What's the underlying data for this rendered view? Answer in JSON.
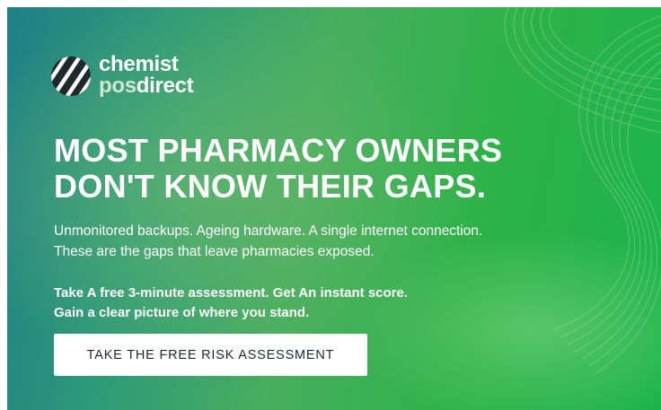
{
  "brand": {
    "word1": "chemist",
    "word2_part1": "pos",
    "word2_part2": "direct",
    "icon": "striped-globe-logo-icon"
  },
  "headline": {
    "line1": "MOST PHARMACY OWNERS",
    "line2": "DON'T KNOW THEIR GAPS."
  },
  "subtext": {
    "line1": "Unmonitored backups. Ageing hardware. A single internet connection.",
    "line2": "These are the gaps that leave pharmacies exposed."
  },
  "offer": {
    "line1": "Take A free 3-minute assessment. Get An instant score.",
    "line2": "Gain a clear picture of where you stand."
  },
  "cta": {
    "label": "TAKE THE FREE RISK ASSESSMENT"
  },
  "colors": {
    "gradient_start": "#1f7f86",
    "gradient_end": "#1db44c",
    "text": "#ffffff",
    "button_bg": "#ffffff",
    "button_text": "#1e2a2a"
  }
}
